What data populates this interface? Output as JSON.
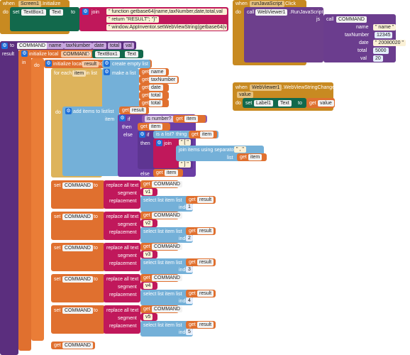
{
  "colors": {
    "event": "#c88a21",
    "procedure": "#5b2e7e",
    "variable": "#e0702f",
    "list": "#74b0d8",
    "logic": "#6b3ea5",
    "text": "#c0185b",
    "component": "#12694c"
  },
  "screen_init": {
    "when": "when",
    "component": "Screen1",
    "event": ".Initialize",
    "do": "do",
    "set": "set",
    "target": "TextBox1",
    "prop": "Text",
    "to": "to",
    "join": "join",
    "str1": "\" function getbase64(name,taxNumber,date,total,val",
    "str2": "\" return \"RESULT\"; \"}\" ",
    "str3": "\" window.AppInventor.setWebViewString(getbase64(v1 "
  },
  "btn_click": {
    "when": "when",
    "component": "runJavaScript",
    "event": ".Click",
    "do": "do",
    "call": "call",
    "target": "WebViewer1",
    "method": ".RunJavaScript",
    "js": "js",
    "call2": "call",
    "proc": "COMMAND",
    "params": [
      {
        "name": "name",
        "value": "\" name \""
      },
      {
        "name": "taxNumber",
        "value": "12345"
      },
      {
        "name": "date",
        "value": "\" 20080020 \""
      },
      {
        "name": "total",
        "value": "5000"
      },
      {
        "name": "val",
        "value": "20"
      }
    ]
  },
  "webview_change": {
    "when": "when",
    "component": "WebViewer1",
    "event": ".WebViewStringChange",
    "param": "value",
    "do": "do",
    "set": "set",
    "target": "Label1",
    "prop": "Text",
    "to": "to",
    "get": "get",
    "var": "value"
  },
  "procedure": {
    "to": "to",
    "name": "COMMAND",
    "params": [
      "name",
      "taxNumber",
      "date",
      "total",
      "val"
    ],
    "result": "result",
    "init_local": "initialize local",
    "local_var": "COMMAND",
    "to2": "to",
    "textbox": "TextBox1",
    "text_prop": "Text",
    "in": "in",
    "do": "do",
    "init_local2": "initialize local",
    "result_var": "result",
    "create_list": "create empty list",
    "for_each": "for each",
    "item": "item",
    "in_list": "in list",
    "make_list": "make a list",
    "get": "get",
    "list_vars": [
      "name",
      "taxNumber",
      "date",
      "total",
      "total"
    ],
    "add_items": "add items to list",
    "list_lbl": "list",
    "item_lbl": "item",
    "if": "if",
    "then": "then",
    "else": "else",
    "is_number": "is number?",
    "is_list": "is a list?",
    "thing": "thing",
    "join": "join",
    "quote": "\" [ \"",
    "join_sep": "join items using separator",
    "sep": "\" , \"",
    "close": "\" ] \"",
    "set": "set",
    "replace_all": "replace all text",
    "segment": "segment",
    "replacement": "replacement",
    "select_item": "select list item",
    "index": "index",
    "replacements": [
      {
        "seg": "v1",
        "idx": "1"
      },
      {
        "seg": "v2",
        "idx": "2"
      },
      {
        "seg": "v3",
        "idx": "3"
      },
      {
        "seg": "v4",
        "idx": "4"
      },
      {
        "seg": "v5",
        "idx": "5"
      }
    ],
    "result_lbl": "result",
    "final_var": "COMMAND"
  }
}
